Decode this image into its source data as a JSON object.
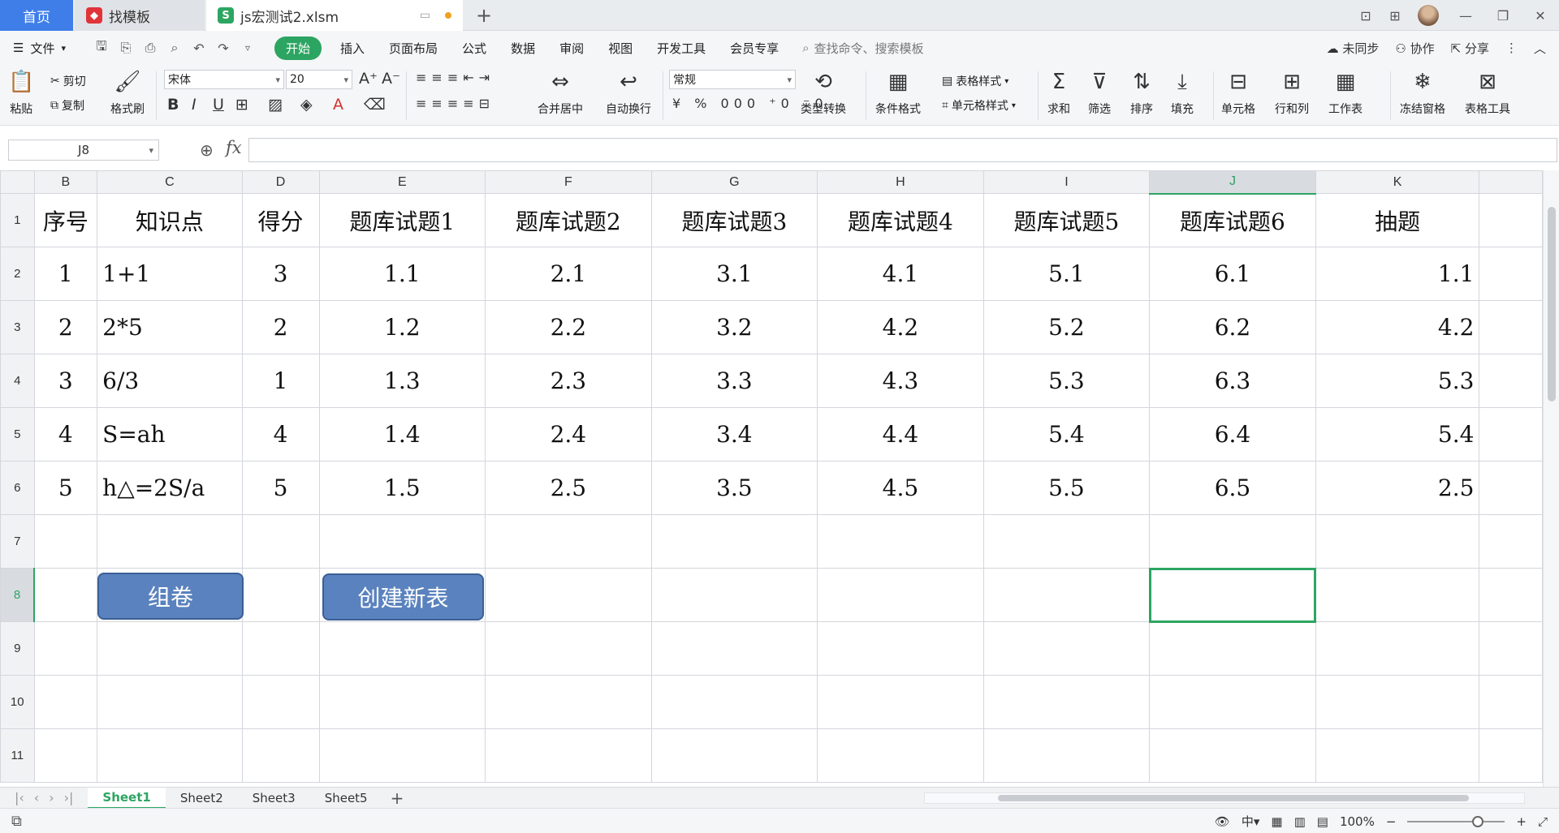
{
  "titlebar": {
    "home_tab": "首页",
    "template_tab": "找模板",
    "doc_tab": "js宏测试2.xlsm",
    "new_tab": "+"
  },
  "menu": {
    "file": "文件",
    "items": [
      "开始",
      "插入",
      "页面布局",
      "公式",
      "数据",
      "审阅",
      "视图",
      "开发工具",
      "会员专享"
    ],
    "search_placeholder": "查找命令、搜索模板",
    "sync": "未同步",
    "collab": "协作",
    "share": "分享"
  },
  "ribbon": {
    "paste": "粘贴",
    "cut": "剪切",
    "copy": "复制",
    "format_painter": "格式刷",
    "font_name": "宋体",
    "font_size": "20",
    "merge_center": "合并居中",
    "wrap_text": "自动换行",
    "number_format": "常规",
    "type_convert": "类型转换",
    "conditional_format": "条件格式",
    "table_style": "表格样式",
    "cell_style": "单元格样式",
    "sum": "求和",
    "filter": "筛选",
    "sort": "排序",
    "fill": "填充",
    "cell": "单元格",
    "row_col": "行和列",
    "worksheet": "工作表",
    "freeze": "冻结窗格",
    "table_tools": "表格工具"
  },
  "formula_bar": {
    "name_box": "J8",
    "fx": "fx",
    "formula": ""
  },
  "sheet": {
    "columns": [
      "B",
      "C",
      "D",
      "E",
      "F",
      "G",
      "H",
      "I",
      "J",
      "K"
    ],
    "rows": [
      "1",
      "2",
      "3",
      "4",
      "5",
      "6",
      "7",
      "8",
      "9",
      "10",
      "11"
    ],
    "header_row": [
      "序号",
      "知识点",
      "得分",
      "题库试题1",
      "题库试题2",
      "题库试题3",
      "题库试题4",
      "题库试题5",
      "题库试题6",
      "抽题"
    ],
    "data": [
      [
        "1",
        "1+1",
        "3",
        "1.1",
        "2.1",
        "3.1",
        "4.1",
        "5.1",
        "6.1",
        "1.1"
      ],
      [
        "2",
        "2*5",
        "2",
        "1.2",
        "2.2",
        "3.2",
        "4.2",
        "5.2",
        "6.2",
        "4.2"
      ],
      [
        "3",
        "6/3",
        "1",
        "1.3",
        "2.3",
        "3.3",
        "4.3",
        "5.3",
        "6.3",
        "5.3"
      ],
      [
        "4",
        "S=ah",
        "4",
        "1.4",
        "2.4",
        "3.4",
        "4.4",
        "5.4",
        "6.4",
        "5.4"
      ],
      [
        "5",
        "h△=2S/a",
        "5",
        "1.5",
        "2.5",
        "3.5",
        "4.5",
        "5.5",
        "6.5",
        "2.5"
      ]
    ],
    "selected_cell": "J8"
  },
  "buttons": {
    "assemble": "组卷",
    "create_sheet": "创建新表"
  },
  "sheet_tabs": [
    "Sheet1",
    "Sheet2",
    "Sheet3",
    "Sheet5"
  ],
  "status": {
    "zoom": "100%"
  },
  "colors": {
    "accent": "#2da562",
    "home_tab": "#3f7ee8",
    "shape_button": "#5a82be"
  }
}
